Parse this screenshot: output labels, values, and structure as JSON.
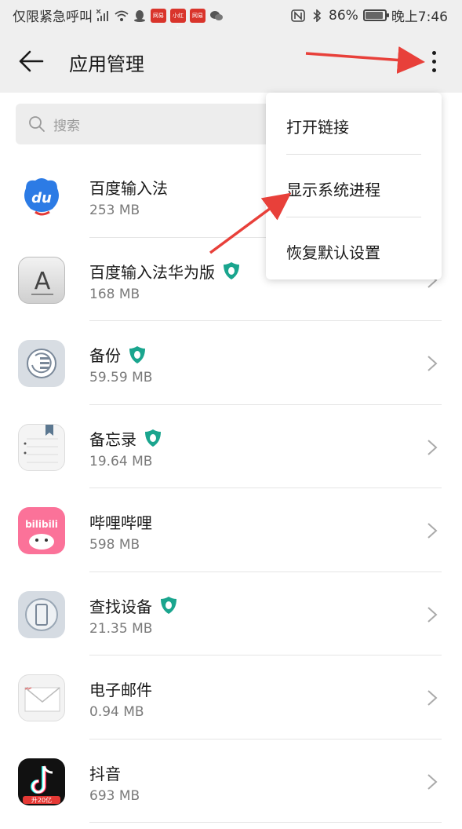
{
  "status_bar": {
    "left_text": "仅限紧急呼叫",
    "battery": "86%",
    "time": "晚上7:46",
    "badges": [
      "网易",
      "小红书",
      "网易"
    ]
  },
  "toolbar": {
    "title": "应用管理",
    "back_icon": "arrow-left-icon",
    "more_icon": "more-vertical-icon"
  },
  "search": {
    "placeholder": "搜索"
  },
  "apps": [
    {
      "name": "百度输入法",
      "size": "253 MB",
      "shield": false
    },
    {
      "name": "百度输入法华为版",
      "size": "168 MB",
      "shield": true
    },
    {
      "name": "备份",
      "size": "59.59 MB",
      "shield": true
    },
    {
      "name": "备忘录",
      "size": "19.64 MB",
      "shield": true
    },
    {
      "name": "哔哩哔哩",
      "size": "598 MB",
      "shield": false
    },
    {
      "name": "查找设备",
      "size": "21.35 MB",
      "shield": true
    },
    {
      "name": "电子邮件",
      "size": "0.94 MB",
      "shield": false
    },
    {
      "name": "抖音",
      "size": "693 MB",
      "shield": false
    }
  ],
  "menu": {
    "items": [
      "打开链接",
      "显示系统进程",
      "恢复默认设置"
    ]
  },
  "colors": {
    "accent_arrow": "#e8403a",
    "shield": "#1aa58e",
    "background": "#ffffff",
    "toolbar": "#efefef"
  },
  "app_icon_labels": {
    "baidu": "du",
    "baidu_huawei": "A",
    "bilibili": "bilibili",
    "douyin_badge": "升20亿"
  }
}
